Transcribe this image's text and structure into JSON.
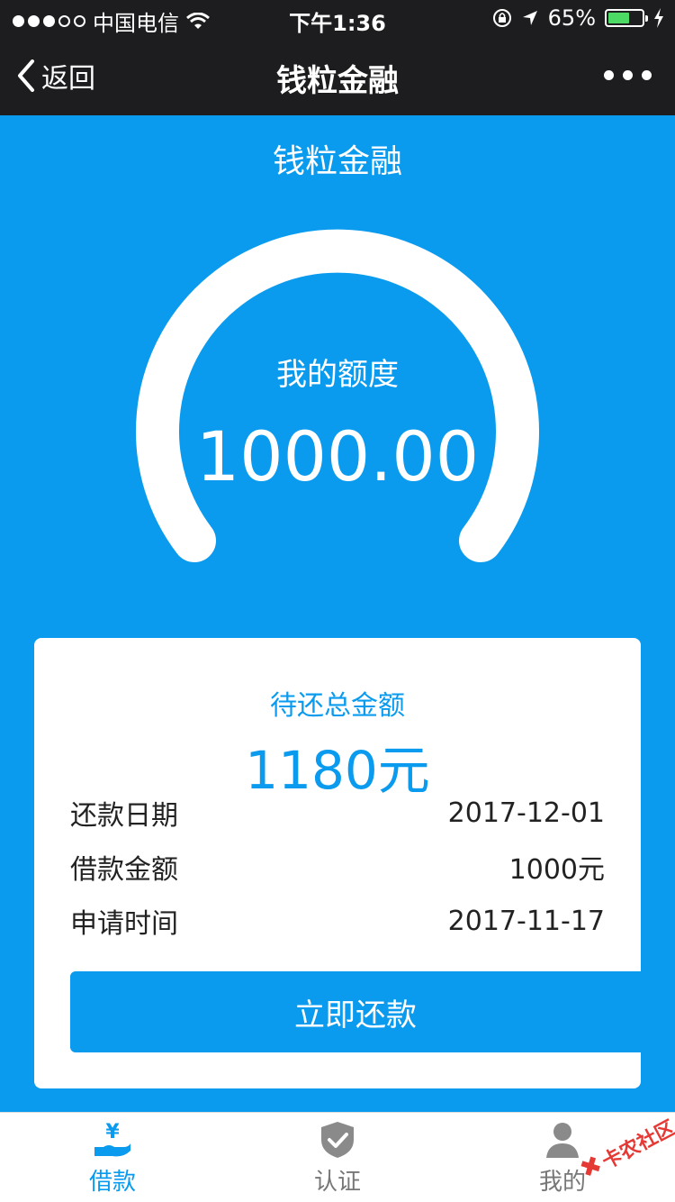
{
  "status_bar": {
    "carrier": "中国电信",
    "time": "下午1:36",
    "battery": "65%",
    "battery_level": 0.65,
    "signal_bars": 3
  },
  "nav": {
    "back_label": "返回",
    "title": "钱粒金融"
  },
  "hero": {
    "title": "钱粒金融",
    "quota_label": "我的额度",
    "quota_value": "1000.00"
  },
  "card": {
    "due_label": "待还总金额",
    "due_value": "1180元",
    "rows": [
      {
        "label": "还款日期",
        "value": "2017-12-01"
      },
      {
        "label": "借款金额",
        "value": "1000元"
      },
      {
        "label": "申请时间",
        "value": "2017-11-17"
      }
    ],
    "pay_button": "立即还款"
  },
  "tabs": [
    {
      "label": "借款",
      "icon": "loan-icon",
      "active": true
    },
    {
      "label": "认证",
      "icon": "shield-check-icon",
      "active": false
    },
    {
      "label": "我的",
      "icon": "user-icon",
      "active": false
    }
  ],
  "watermark": {
    "text": "卡农社区",
    "icon": "kanong-logo"
  },
  "colors": {
    "primary": "#0a9bef",
    "bar_dark": "#1d1d1f",
    "battery_green": "#4cd964",
    "watermark_red": "#e53935"
  }
}
